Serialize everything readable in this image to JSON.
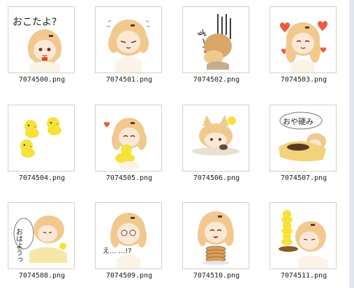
{
  "window": {
    "scroll_edge": "scrollbar-edge"
  },
  "files": [
    {
      "name": "7074500.png",
      "caption": "おこたよ?"
    },
    {
      "name": "7074501.png",
      "caption": ""
    },
    {
      "name": "7074502.png",
      "caption": "ず~ん"
    },
    {
      "name": "7074503.png",
      "caption": ""
    },
    {
      "name": "7074504.png",
      "caption": ""
    },
    {
      "name": "7074505.png",
      "caption": ""
    },
    {
      "name": "7074506.png",
      "caption": ""
    },
    {
      "name": "7074507.png",
      "caption": "おや硬み"
    },
    {
      "name": "7074508.png",
      "caption": "おはようっ"
    },
    {
      "name": "7074509.png",
      "caption": "え... ...!?"
    },
    {
      "name": "7074510.png",
      "caption": ""
    },
    {
      "name": "7074511.png",
      "caption": ""
    }
  ],
  "colors": {
    "hair": "#f1c98f",
    "hair_shade": "#d9a76a",
    "skin": "#fde8d7",
    "chick": "#f7e23a",
    "accent_red": "#e0442c",
    "heart": "#ef5a3c",
    "frame": "#d6d0c4"
  }
}
